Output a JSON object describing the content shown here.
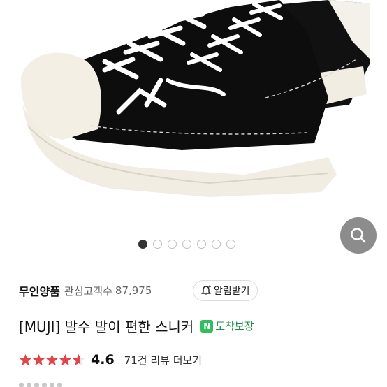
{
  "gallery": {
    "image_alt": "Black canvas low-top sneaker with white laces and white rubber sole",
    "page_count": 7,
    "active_index": 0,
    "zoom_icon": "search-icon"
  },
  "brand": {
    "name": "무인양품",
    "fans_label": "관심고객수",
    "fans_count": "87,975",
    "alert_label": "알림받기",
    "alert_icon": "bell-plus-icon"
  },
  "product": {
    "title": "[MUJI] 발수 발이 편한 스니커",
    "badge_letter": "N",
    "badge_label": "도착보장",
    "badge_color": "#2fbf5e"
  },
  "rating": {
    "score": "4.6",
    "stars_value": 4.6,
    "stars_max": 5,
    "star_color": "#e0454a",
    "reviews_count": "71건",
    "reviews_label": "리뷰 더보기"
  }
}
